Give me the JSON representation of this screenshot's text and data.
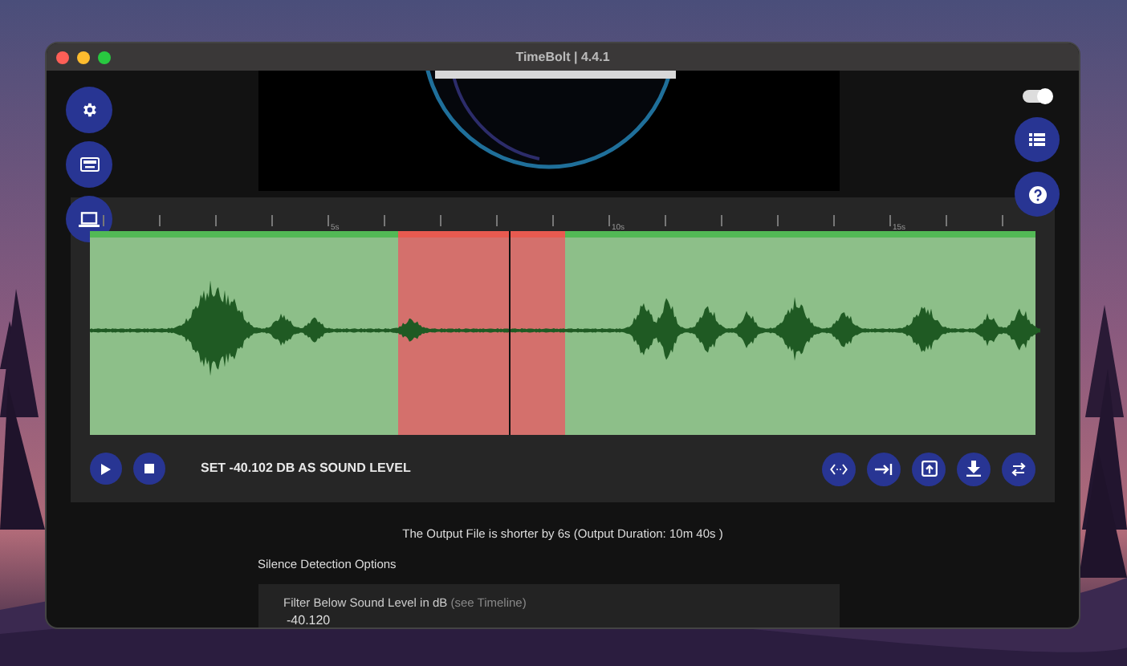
{
  "window": {
    "title": "TimeBolt | 4.4.1"
  },
  "toggle": {
    "on": true
  },
  "ruler": {
    "ticks": [
      "5s",
      "10s",
      "15s"
    ]
  },
  "segments": [
    {
      "kind": "keep"
    },
    {
      "kind": "cut"
    },
    {
      "kind": "keep"
    }
  ],
  "playhead": {
    "level": 0.443
  },
  "sound_level_button": "SET -40.102 DB AS SOUND LEVEL",
  "summary": "The Output File is shorter by 6s (Output Duration: 10m 40s )",
  "section_title": "Silence Detection Options",
  "filter": {
    "label": "Filter Below Sound Level in dB",
    "hint": "(see Timeline)",
    "value": "-40.120"
  }
}
